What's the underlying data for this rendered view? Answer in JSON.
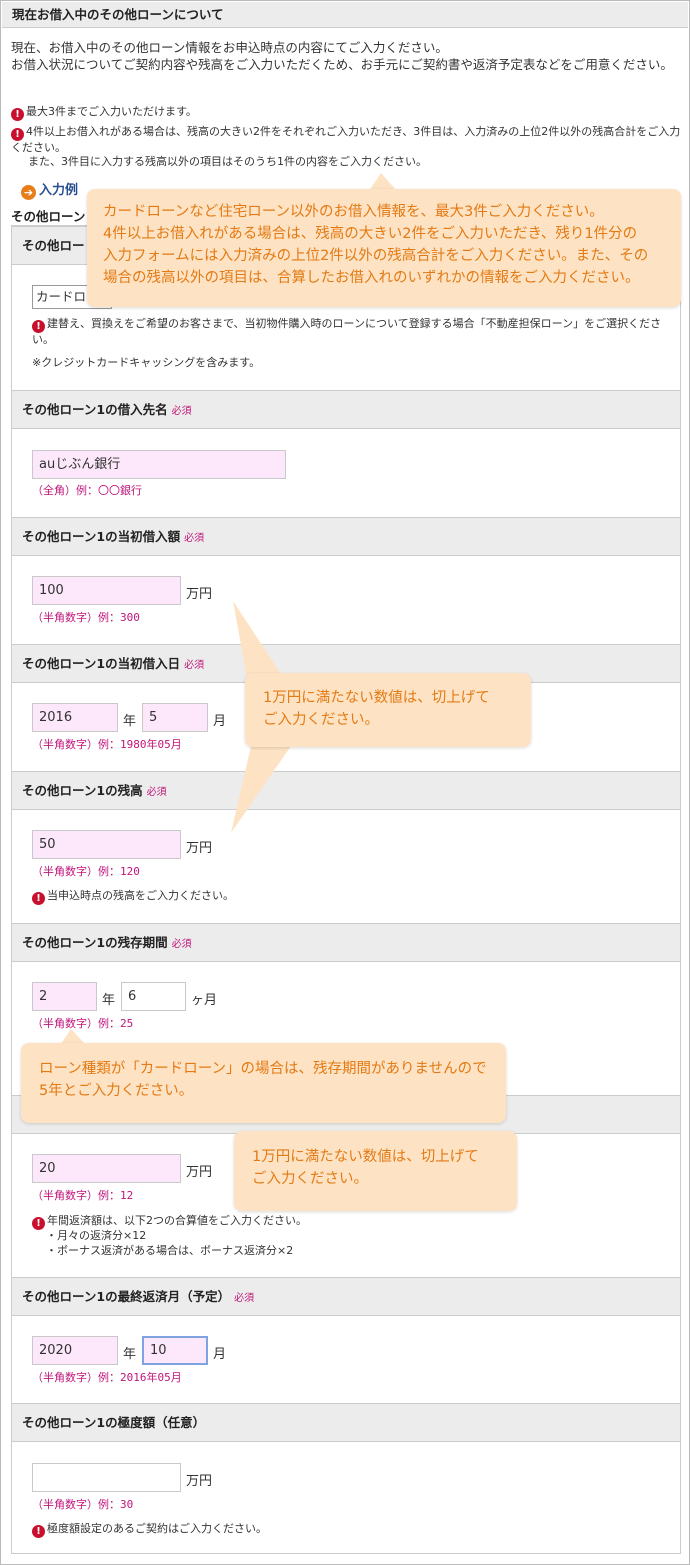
{
  "header": {
    "title": "現在お借入中のその他ローンについて"
  },
  "intro": {
    "line1": "現在、お借入中のその他ローン情報をお申込時点の内容にてご入力ください。",
    "line2": "お借入状況についてご契約内容や残高をご入力いただくため、お手元にご契約書や返済予定表などをご用意ください。"
  },
  "notes": {
    "note1": "最大3件までご入力いただけます。",
    "note2": "4件以上お借入れがある場合は、残高の大きい2件をそれぞれご入力いただき、3件目は、入力済みの上位2件以外の残高合計をご入力ください。",
    "note3": "また、3件目に入力する残高以外の項目はそのうち1件の内容をご入力ください。"
  },
  "example_link": "入力例",
  "section_title": "その他ローン",
  "loan_type": {
    "label": "その他ロー",
    "selected": "カードロ",
    "note": "建替え、買換えをご希望のお客さまで、当初物件購入時のローンについて登録する場合「不動産担保ローン」をご選択ください。",
    "note2": "※クレジットカードキャッシングを含みます。"
  },
  "required_label": "必須",
  "lender": {
    "label": "その他ローン1の借入先名",
    "value": "auじぶん銀行",
    "hint": "（全角）例：〇〇銀行"
  },
  "initial_amount": {
    "label": "その他ローン1の当初借入額",
    "value": "100",
    "unit": "万円",
    "hint": "（半角数字）例：300"
  },
  "initial_date": {
    "label": "その他ローン1の当初借入日",
    "year": "2016",
    "year_unit": "年",
    "month": "5",
    "month_unit": "月",
    "hint": "（半角数字）例：1980年05月"
  },
  "balance": {
    "label": "その他ローン1の残高",
    "value": "50",
    "unit": "万円",
    "hint": "（半角数字）例：120",
    "note": "当申込時点の残高をご入力ください。"
  },
  "remaining_period": {
    "label": "その他ローン1の残存期間",
    "year": "2",
    "year_unit": "年",
    "month": "6",
    "month_unit": "ヶ月",
    "hint": "（半角数字）例：25"
  },
  "annual_repayment": {
    "value": "20",
    "unit": "万円",
    "hint": "（半角数字）例：12",
    "note": "年間返済額は、以下2つの合算値をご入力ください。",
    "bullet1": "・月々の返済分×12",
    "bullet2": "・ボーナス返済がある場合は、ボーナス返済分×2"
  },
  "final_month": {
    "label": "その他ローン1の最終返済月（予定）",
    "year": "2020",
    "year_unit": "年",
    "month": "10",
    "month_unit": "月",
    "hint": "（半角数字）例：2016年05月"
  },
  "limit": {
    "label": "その他ローン1の極度額（任意）",
    "value": "",
    "unit": "万円",
    "hint": "（半角数字）例：30",
    "note": "極度額設定のあるご契約はご入力ください。"
  },
  "callouts": {
    "top_line1": "カードローンなど住宅ローン以外のお借入情報を、最大3件ご入力ください。",
    "top_line2": "4件以上お借入れがある場合は、残高の大きい2件をご入力いただき、残り1件分の",
    "top_line3": "入力フォームには入力済みの上位2件以外の残高合計をご入力ください。また、その",
    "top_line4": "場合の残高以外の項目は、合算したお借入れのいずれかの情報をご入力ください。",
    "round_up_line1": "1万円に満たない数値は、切上げて",
    "round_up_line2": "ご入力ください。",
    "card_line1": "ローン種類が「カードローン」の場合は、残存期間がありませんので",
    "card_line2": "5年とご入力ください。",
    "round_up2_line1": "1万円に満たない数値は、切上げて",
    "round_up2_line2": "ご入力ください。"
  },
  "colors": {
    "callout_bg": "#fde3c4",
    "callout_text": "#e47a14",
    "required": "#c0157a",
    "input_bg": "#fde8fb"
  }
}
